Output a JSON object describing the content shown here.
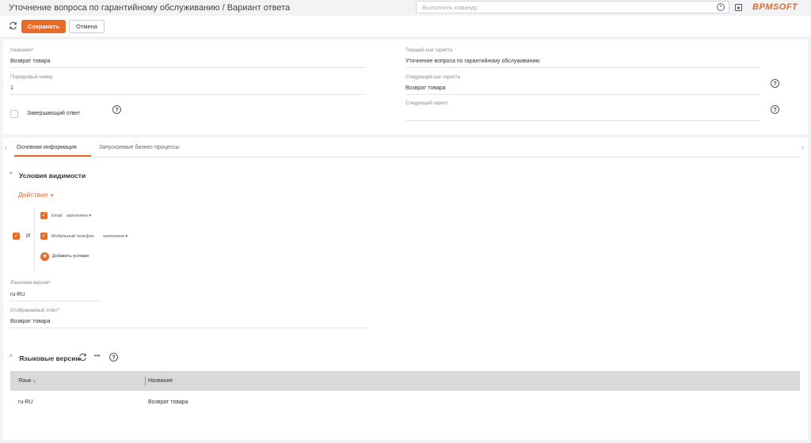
{
  "header": {
    "title": "Уточнение вопроса по гарантийному обслуживанию / Вариант ответа",
    "command_placeholder": "Выполнить команду",
    "logo": "BPMSOFT"
  },
  "toolbar": {
    "save_label": "Сохранить",
    "cancel_label": "Отмена"
  },
  "form": {
    "name_label": "Название",
    "name_value": "Возврат товара",
    "order_label": "Порядковый номер",
    "order_value": "1",
    "final_label": "Завершающий ответ",
    "current_step_label": "Текущий шаг скрипта",
    "current_step_value": "Уточнение вопроса по гарантийному обслуживанию",
    "next_step_label": "Следующий шаг скрипта",
    "next_step_value": "Возврат товара",
    "next_script_label": "Следующий скрипт",
    "next_script_value": "",
    "required_mark": "*",
    "help_glyph": "?"
  },
  "tabs": [
    {
      "label": "Основная информация",
      "active": true
    },
    {
      "label": "Запускаемые бизнес-процессы",
      "active": false
    }
  ],
  "visibility": {
    "title": "Условия видимости",
    "actions_label": "Действия",
    "group_operator": "И",
    "conditions": [
      {
        "field": "Email",
        "operator": "заполнено"
      },
      {
        "field": "Мобильный телефон",
        "operator": "заполнено"
      }
    ],
    "add_condition_label": "Добавить условие"
  },
  "details": {
    "lang_version_label": "Языковая версия",
    "lang_version_value": "ru-RU",
    "display_answer_label": "Отображаемый ответ",
    "display_answer_value": "Возврат товара"
  },
  "lang_versions": {
    "title": "Языковые версии",
    "more_glyph": "•••",
    "columns": [
      "Язык",
      "Название"
    ],
    "rows": [
      [
        "ru-RU",
        "Возврат товара"
      ]
    ]
  },
  "colors": {
    "accent": "#e86b2a",
    "background": "#f2f3f5",
    "grid_header": "#d9d9d9"
  }
}
